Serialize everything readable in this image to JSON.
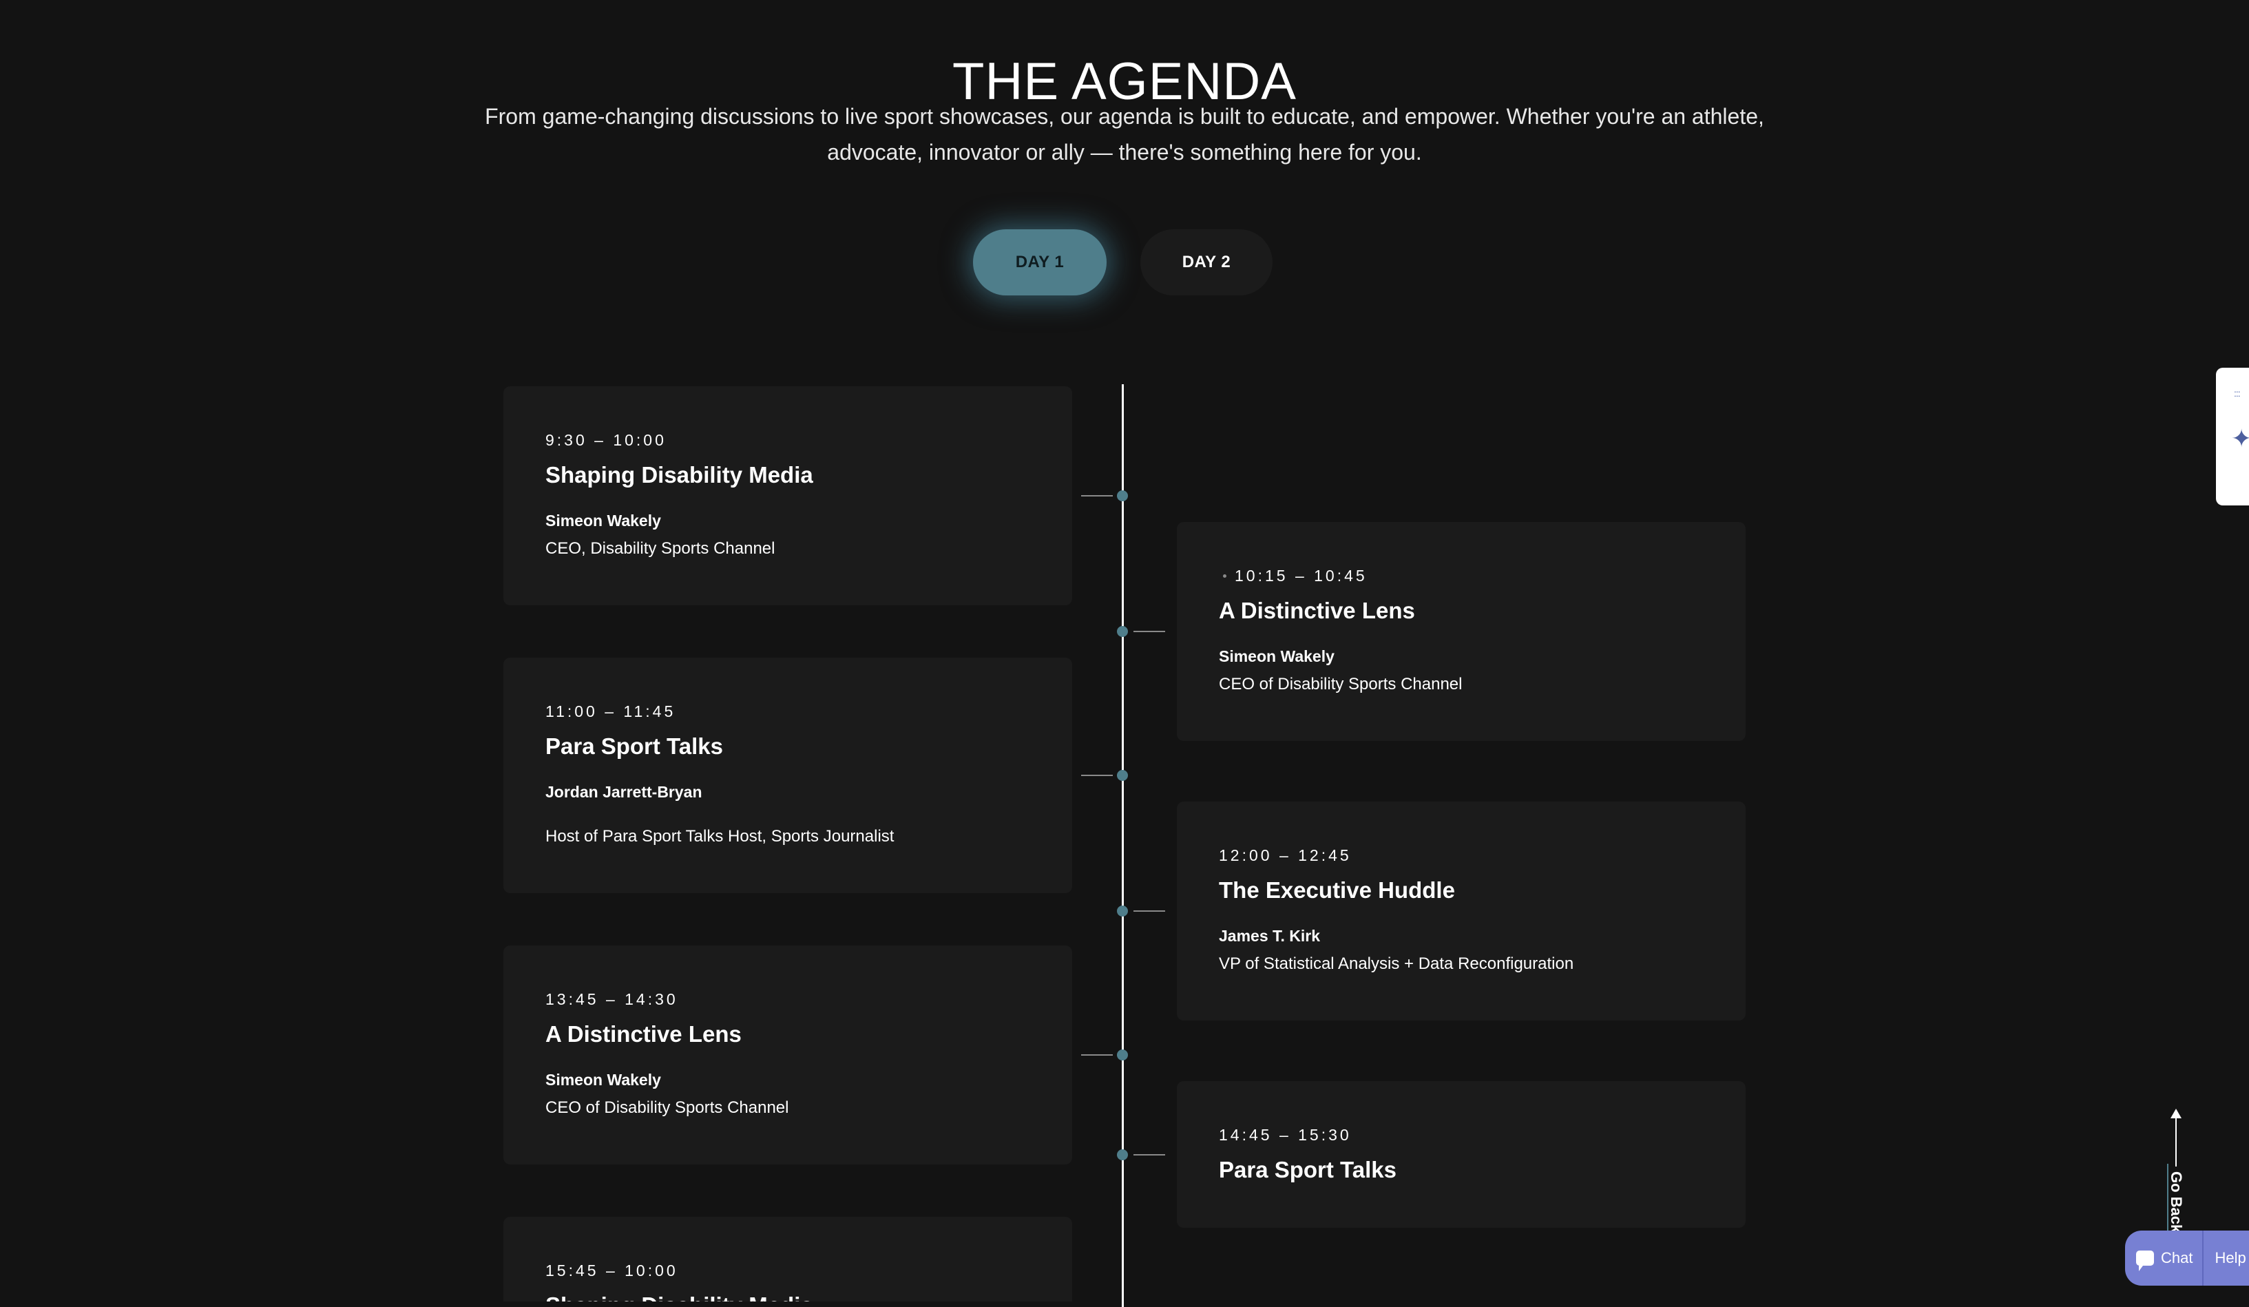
{
  "header": {
    "title": "THE AGENDA",
    "intro_line1": "From game-changing discussions to live sport showcases, our agenda is built to educate, and empower. Whether you're an athlete,",
    "intro_line2": "advocate, innovator or ally — there's something here for you."
  },
  "tabs": [
    {
      "label": "DAY 1",
      "active": true
    },
    {
      "label": "DAY 2",
      "active": false
    }
  ],
  "sessions": [
    {
      "time": "9:30 – 10:00",
      "title": "Shaping Disability Media",
      "speaker": "Simeon Wakely",
      "role": "CEO, Disability Sports Channel"
    },
    {
      "time": "10:15 – 10:45",
      "title": "A Distinctive Lens",
      "speaker": "Simeon Wakely",
      "role": "CEO of Disability Sports Channel"
    },
    {
      "time": "11:00 – 11:45",
      "title": "Para Sport Talks",
      "speaker": "Jordan Jarrett-Bryan",
      "role": "Host of Para Sport Talks Host, Sports Journalist"
    },
    {
      "time": "12:00 – 12:45",
      "title": "The Executive Huddle",
      "speaker": "James T. Kirk",
      "role": "VP of Statistical Analysis + Data Reconfiguration"
    },
    {
      "time": "13:45 – 14:30",
      "title": "A Distinctive Lens",
      "speaker": "Simeon Wakely",
      "role": "CEO of Disability Sports Channel"
    },
    {
      "time": "14:45 – 15:30",
      "title": "Para Sport Talks",
      "speaker": "",
      "role": ""
    },
    {
      "time": "15:45 – 10:00",
      "title": "Shaping Disability Media",
      "speaker": "",
      "role": ""
    }
  ],
  "widgets": {
    "go_back_label": "Go Back Up",
    "chat_label": "Chat",
    "help_label": "Help",
    "accent_color": "#4f7e8b",
    "widget_color": "#7780d3"
  }
}
